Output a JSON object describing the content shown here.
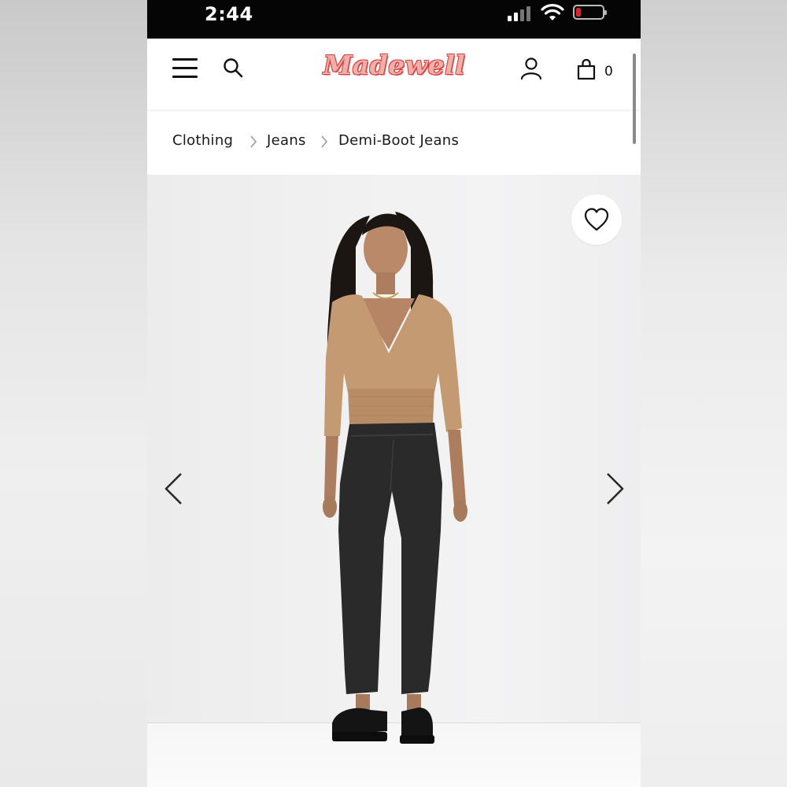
{
  "status_bar": {
    "time": "2:44"
  },
  "header": {
    "brand": "Madewell",
    "cart_count": "0"
  },
  "breadcrumb": {
    "items": [
      "Clothing",
      "Jeans",
      "Demi-Boot Jeans"
    ]
  },
  "colors": {
    "logo_fill": "#f1b0a7",
    "logo_outline": "#d6454a",
    "battery_low": "#e0242b"
  },
  "icons": [
    "menu-icon",
    "search-icon",
    "account-icon",
    "shopping-bag-icon",
    "heart-icon",
    "chevron-left-icon",
    "chevron-right-icon",
    "chevron-right-separator-icon"
  ]
}
